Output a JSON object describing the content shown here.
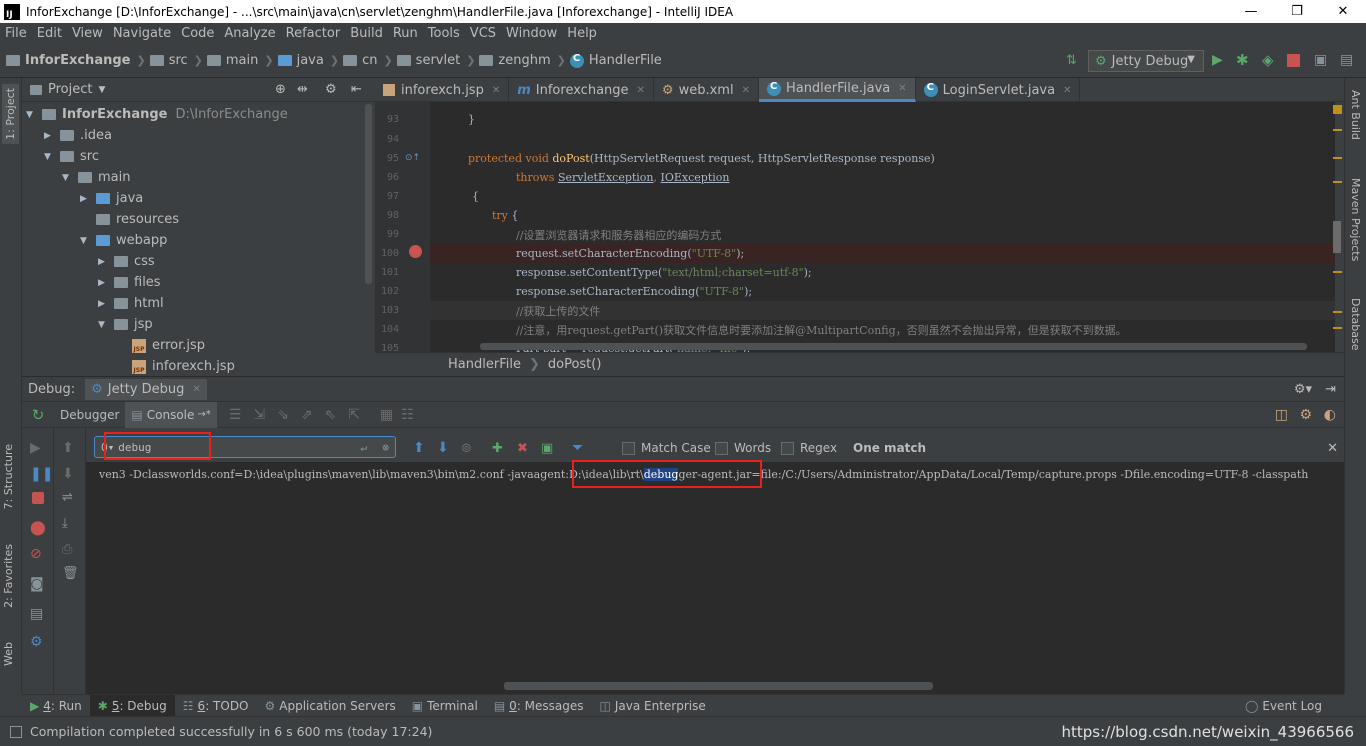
{
  "window": {
    "title": "InforExchange [D:\\InforExchange] - ...\\src\\main\\java\\cn\\servlet\\zenghm\\HandlerFile.java [Inforexchange] - IntelliJ IDEA",
    "logo": "IJ",
    "minimize": "—",
    "maximize": "❐",
    "close": "✕"
  },
  "menu": [
    "File",
    "Edit",
    "View",
    "Navigate",
    "Code",
    "Analyze",
    "Refactor",
    "Build",
    "Run",
    "Tools",
    "VCS",
    "Window",
    "Help"
  ],
  "nav": {
    "crumbs": [
      "InforExchange",
      "src",
      "main",
      "java",
      "cn",
      "servlet",
      "zenghm",
      "HandlerFile"
    ],
    "run_config": "Jetty Debug"
  },
  "project": {
    "title": "Project",
    "tree": [
      {
        "label": "InforExchange",
        "extra": "D:\\InforExchange",
        "type": "root"
      },
      {
        "label": ".idea",
        "type": "folder"
      },
      {
        "label": "src",
        "type": "folder"
      },
      {
        "label": "main",
        "type": "folder"
      },
      {
        "label": "java",
        "type": "folder-blue"
      },
      {
        "label": "resources",
        "type": "folder"
      },
      {
        "label": "webapp",
        "type": "folder-blue"
      },
      {
        "label": "css",
        "type": "folder"
      },
      {
        "label": "files",
        "type": "folder"
      },
      {
        "label": "html",
        "type": "folder"
      },
      {
        "label": "jsp",
        "type": "folder"
      },
      {
        "label": "error.jsp",
        "type": "jsp"
      },
      {
        "label": "inforexch.jsp",
        "type": "jsp"
      }
    ]
  },
  "left_strip": {
    "project": "1: Project",
    "structure": "7: Structure",
    "favorites": "2: Favorites",
    "web": "Web"
  },
  "right_strip": {
    "ant": "Ant Build",
    "maven": "Maven Projects",
    "database": "Database"
  },
  "editor": {
    "tabs": [
      {
        "label": "inforexch.jsp",
        "active": false
      },
      {
        "label": "Inforexchange",
        "active": false
      },
      {
        "label": "web.xml",
        "active": false
      },
      {
        "label": "HandlerFile.java",
        "active": true
      },
      {
        "label": "LoginServlet.java",
        "active": false
      }
    ],
    "line_numbers": [
      "93",
      "94",
      "95",
      "96",
      "97",
      "98",
      "99",
      "100",
      "101",
      "102",
      "103",
      "104",
      "105"
    ],
    "code": {
      "l93": "}",
      "l95_kw": "protected void ",
      "l95_fn": "doPost",
      "l95_rest": "(HttpServletRequest request, HttpServletResponse response)",
      "l96_kw": "throws ",
      "l96_ex1": "ServletException",
      "l96_sep": ", ",
      "l96_ex2": "IOException",
      "l97": "{",
      "l98_kw": "try ",
      "l98_rest": "{",
      "l99": "//设置浏览器请求和服务器相应的编码方式",
      "l100_a": "request.setCharacterEncoding(",
      "l100_s": "\"UTF-8\"",
      "l100_b": ");",
      "l101_a": "response.setContentType(",
      "l101_s": "\"text/html;charset=utf-8\"",
      "l101_b": ");",
      "l102_a": "response.setCharacterEncoding(",
      "l102_s": "\"UTF-8\"",
      "l102_b": ");",
      "l103": "//获取上传的文件",
      "l104": "//注意，用request.getPart()获取文件信息时要添加注解@MultipartConfig，否则虽然不会抛出异常，但是获取不到数据。",
      "l105_a": "Part part = request.getPart( ",
      "l105_hint": "name: ",
      "l105_s": "\"file\"",
      "l105_b": ");"
    },
    "breadcrumb": [
      "HandlerFile",
      "doPost()"
    ]
  },
  "debug": {
    "label": "Debug:",
    "config": "Jetty Debug",
    "tabs": [
      {
        "label": "Debugger",
        "active": false
      },
      {
        "label": "Console",
        "active": true
      }
    ],
    "tab_suffix": "→*",
    "search": {
      "value": "debug",
      "match_case": "Match Case",
      "words": "Words",
      "regex": "Regex",
      "result": "One match"
    },
    "console": {
      "before": "ven3 -Dclassworlds.conf=D:\\idea\\plugins\\maven\\lib\\maven3\\bin\\m2.conf -javaagent:D:\\idea\\lib\\rt\\",
      "match": "debug",
      "after": "ger-agent.jar=file:/C:/Users/Administrator/AppData/Local/Temp/capture.props -Dfile.encoding=UTF-8 -classpath"
    }
  },
  "bottom_tabs": [
    {
      "num": "4",
      "label": ": Run",
      "active": false
    },
    {
      "num": "5",
      "label": ": Debug",
      "active": true
    },
    {
      "num": "6",
      "label": ": TODO",
      "active": false
    },
    {
      "num": "",
      "label": "Application Servers",
      "active": false
    },
    {
      "num": "",
      "label": "Terminal",
      "active": false
    },
    {
      "num": "0",
      "label": ": Messages",
      "active": false
    },
    {
      "num": "",
      "label": "Java Enterprise",
      "active": false
    }
  ],
  "event_log": "Event Log",
  "status": {
    "message": "Compilation completed successfully in 6 s 600 ms (today 17:24)",
    "watermark": "https://blog.csdn.net/weixin_43966566"
  },
  "colors": {
    "accent": "#4a88c7",
    "highlight_box": "#e8211a",
    "run_green": "#59a869",
    "stop_red": "#c75450"
  }
}
